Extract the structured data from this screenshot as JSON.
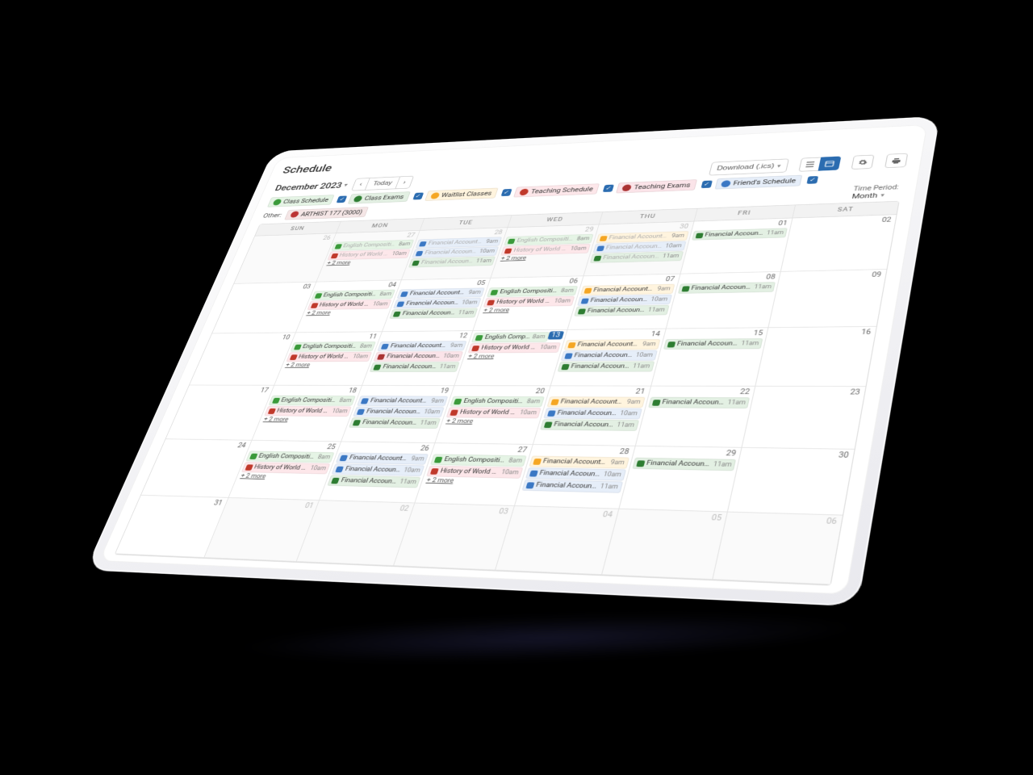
{
  "page_title": "Schedule",
  "month_label": "December 2023",
  "today_label": "Today",
  "download_label": "Download (.ics)",
  "time_period": {
    "label": "Time Period:",
    "value": "Month"
  },
  "day_headers": [
    "SUN",
    "MON",
    "TUE",
    "WED",
    "THU",
    "FRI",
    "SAT"
  ],
  "filters": [
    {
      "key": "class",
      "label": "Class Schedule",
      "checked": true,
      "css": "c-class"
    },
    {
      "key": "exam",
      "label": "Class Exams",
      "checked": true,
      "css": "c-exam"
    },
    {
      "key": "wait",
      "label": "Waitlist Classes",
      "checked": true,
      "css": "c-wait"
    },
    {
      "key": "teach",
      "label": "Teaching Schedule",
      "checked": true,
      "css": "c-teach"
    },
    {
      "key": "texam",
      "label": "Teaching Exams",
      "checked": true,
      "css": "c-texam"
    },
    {
      "key": "friend",
      "label": "Friend's Schedule",
      "checked": true,
      "css": "c-friend"
    }
  ],
  "other_label": "Other:",
  "other_chips": [
    {
      "label": "ARTHIST 177 (3000)",
      "css": "c-other"
    }
  ],
  "more_label": "+ 2 more",
  "event_templates": {
    "eng": {
      "title": "English Composition I (C1)",
      "short": "English Compositi…",
      "time": "8am",
      "css": "c-class"
    },
    "eng2": {
      "title": "English Composition",
      "short": "English Compositi…",
      "time": "8am",
      "css": "c-class"
    },
    "hist": {
      "title": "History of World …",
      "short": "History of World …",
      "time": "10am",
      "css": "c-teach"
    },
    "fin9": {
      "title": "Financial Account…",
      "short": "Financial Account…",
      "time": "9am",
      "css": "c-friend"
    },
    "fin9w": {
      "title": "Financial Account…",
      "short": "Financial Account…",
      "time": "9am",
      "css": "c-wait"
    },
    "fin10": {
      "title": "Financial Account…",
      "short": "Financial Account…",
      "time": "10am",
      "css": "c-friend"
    },
    "fin10x": {
      "title": "Financial Account…",
      "short": "Financial Account…",
      "time": "10am",
      "css": "c-texam"
    },
    "fin11": {
      "title": "Financial Account…",
      "short": "Financial Account…",
      "time": "11am",
      "css": "c-exam"
    },
    "fin11f": {
      "title": "Financial Account…",
      "short": "Financial Account…",
      "time": "11am",
      "css": "c-friend"
    }
  },
  "cells": [
    {
      "num": 26,
      "dim": true,
      "events": []
    },
    {
      "num": 27,
      "dim": true,
      "events": [
        "eng",
        "hist"
      ],
      "more": true
    },
    {
      "num": 28,
      "dim": true,
      "events": [
        "fin9",
        "fin10",
        "fin11"
      ]
    },
    {
      "num": 29,
      "dim": true,
      "events": [
        "eng2",
        "hist"
      ],
      "more": true
    },
    {
      "num": 30,
      "dim": true,
      "events": [
        "fin9w",
        "fin10",
        "fin11"
      ]
    },
    {
      "num": 1,
      "events": [
        "fin11"
      ]
    },
    {
      "num": 2,
      "events": []
    },
    {
      "num": 3,
      "events": []
    },
    {
      "num": 4,
      "events": [
        "eng2",
        "hist"
      ],
      "more": true
    },
    {
      "num": 5,
      "events": [
        "fin9",
        "fin10",
        "fin11"
      ]
    },
    {
      "num": 6,
      "events": [
        "eng2",
        "hist"
      ],
      "more": true
    },
    {
      "num": 7,
      "events": [
        "fin9w",
        "fin10",
        "fin11"
      ]
    },
    {
      "num": 8,
      "events": [
        "fin11"
      ]
    },
    {
      "num": 9,
      "events": []
    },
    {
      "num": 10,
      "events": []
    },
    {
      "num": 11,
      "events": [
        "eng2",
        "hist"
      ],
      "more": true
    },
    {
      "num": 12,
      "events": [
        "fin9",
        "fin10x",
        "fin11"
      ]
    },
    {
      "num": 13,
      "today": true,
      "events": [
        "eng2",
        "hist"
      ],
      "more": true
    },
    {
      "num": 14,
      "events": [
        "fin9w",
        "fin10",
        "fin11"
      ]
    },
    {
      "num": 15,
      "events": [
        "fin11"
      ]
    },
    {
      "num": 16,
      "events": []
    },
    {
      "num": 17,
      "events": []
    },
    {
      "num": 18,
      "events": [
        "eng2",
        "hist"
      ],
      "more": true
    },
    {
      "num": 19,
      "events": [
        "fin9",
        "fin10",
        "fin11"
      ]
    },
    {
      "num": 20,
      "events": [
        "eng2",
        "hist"
      ],
      "more": true
    },
    {
      "num": 21,
      "events": [
        "fin9w",
        "fin10",
        "fin11"
      ]
    },
    {
      "num": 22,
      "events": [
        "fin11"
      ]
    },
    {
      "num": 23,
      "events": []
    },
    {
      "num": 24,
      "events": []
    },
    {
      "num": 25,
      "events": [
        "eng2",
        "hist"
      ],
      "more": true
    },
    {
      "num": 26,
      "events": [
        "fin9",
        "fin10",
        "fin11"
      ]
    },
    {
      "num": 27,
      "events": [
        "eng2",
        "hist"
      ],
      "more": true
    },
    {
      "num": 28,
      "events": [
        "fin9w",
        "fin10",
        "fin11f"
      ]
    },
    {
      "num": 29,
      "events": [
        "fin11"
      ]
    },
    {
      "num": 30,
      "events": []
    },
    {
      "num": 31,
      "events": []
    },
    {
      "num": 1,
      "dim": true,
      "events": []
    },
    {
      "num": 2,
      "dim": true,
      "events": []
    },
    {
      "num": 3,
      "dim": true,
      "events": []
    },
    {
      "num": 4,
      "dim": true,
      "events": []
    },
    {
      "num": 5,
      "dim": true,
      "events": []
    },
    {
      "num": 6,
      "dim": true,
      "events": []
    }
  ]
}
